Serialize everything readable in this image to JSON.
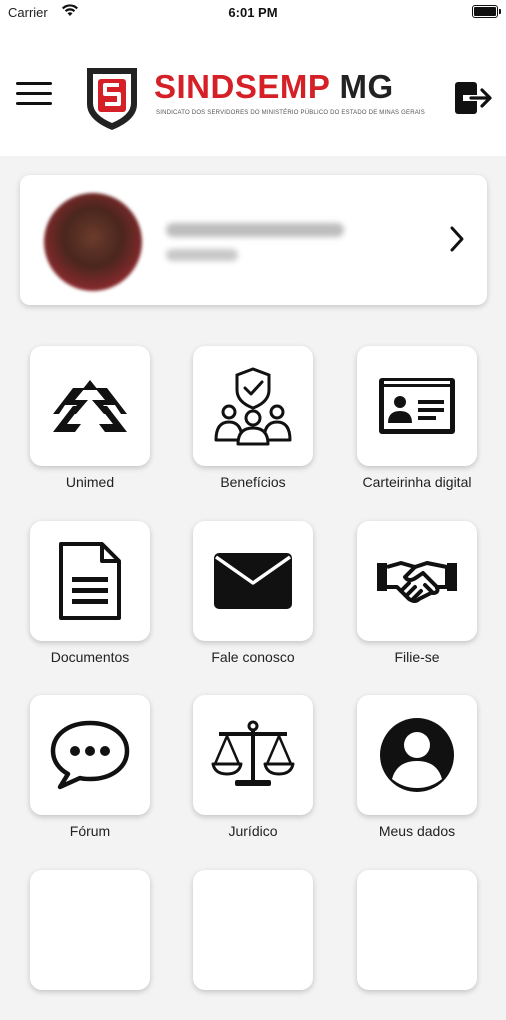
{
  "status_bar": {
    "carrier": "Carrier",
    "time": "6:01 PM"
  },
  "header": {
    "logo_text_red": "SINDSEMP",
    "logo_text_dark": "MG",
    "logo_subtitle": "SINDICATO DOS SERVIDORES DO MINISTÉRIO PÚBLICO DO ESTADO DE MINAS GERAIS"
  },
  "menu": [
    {
      "label": "Unimed",
      "icon": "unimed-icon"
    },
    {
      "label": "Benefícios",
      "icon": "benefits-icon"
    },
    {
      "label": "Carteirinha digital",
      "icon": "id-card-icon"
    },
    {
      "label": "Documentos",
      "icon": "document-icon"
    },
    {
      "label": "Fale conosco",
      "icon": "envelope-icon"
    },
    {
      "label": "Filie-se",
      "icon": "handshake-icon"
    },
    {
      "label": "Fórum",
      "icon": "chat-bubble-icon"
    },
    {
      "label": "Jurídico",
      "icon": "scales-icon"
    },
    {
      "label": "Meus dados",
      "icon": "user-circle-icon"
    }
  ],
  "colors": {
    "brand_red": "#d52027",
    "background": "#f3f3f3"
  }
}
